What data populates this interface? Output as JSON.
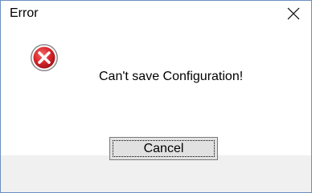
{
  "dialog": {
    "title": "Error",
    "message": "Can't save Configuration!",
    "icon": "error-icon",
    "close_icon": "close-icon",
    "buttons": {
      "cancel_label": "Cancel"
    }
  },
  "colors": {
    "border": "#6b8fbf",
    "footer_background": "#f0f0f0",
    "button_background": "#e1e1e1",
    "error_red": "#d9262b"
  }
}
